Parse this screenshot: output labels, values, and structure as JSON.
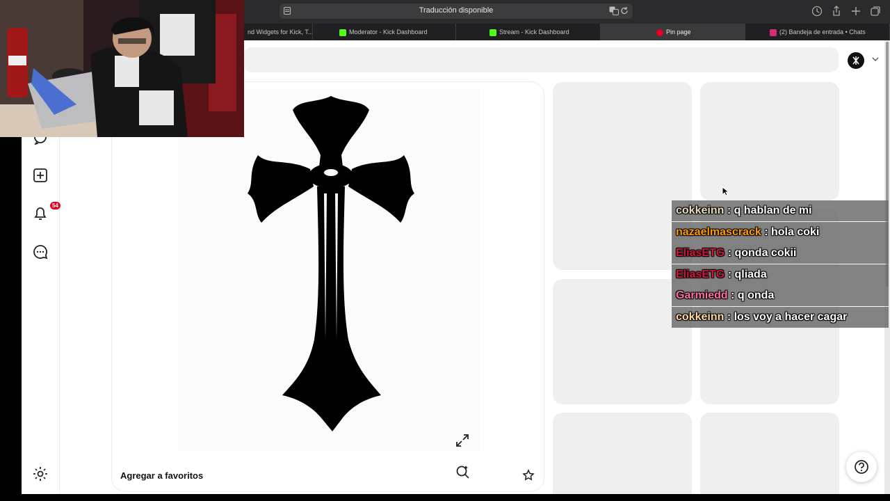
{
  "browser": {
    "address_text": "Traducción disponible",
    "tabs": [
      {
        "label": "nd Widgets for Kick, T...",
        "favicon_color": "#2d2d30"
      },
      {
        "label": "Moderator - Kick Dashboard",
        "favicon_color": "#53fc18"
      },
      {
        "label": "Stream - Kick Dashboard",
        "favicon_color": "#53fc18"
      },
      {
        "label": "Pin page",
        "favicon_color": "#e60023"
      },
      {
        "label": "(2) Bandeja de entrada • Chats",
        "favicon_color": "#d62976"
      }
    ]
  },
  "nav": {
    "notifications_badge": "54"
  },
  "pin": {
    "favorite_label": "Agregar a favoritos"
  },
  "chat": {
    "messages": [
      {
        "user": "cokkeinn",
        "user_color": "#e8dcc0",
        "text": ": q hablan de mi"
      },
      {
        "user": "nazaelmascrack",
        "user_color": "#ff9a00",
        "text": ": hola coki"
      },
      {
        "user": "EliasETG",
        "user_color": "#d4143c",
        "text": ": qonda cokii"
      },
      {
        "user": "EliasETG",
        "user_color": "#d4143c",
        "text": ": qliada"
      },
      {
        "user": "Garmiedd",
        "user_color": "#ff6fa0",
        "text": ": q onda"
      },
      {
        "user": "cokkeinn",
        "user_color": "#ffd7a0",
        "text": ": los voy a hacer cagar"
      }
    ]
  },
  "colors": {
    "pinterest_red": "#e60023",
    "kick_green": "#53fc18"
  }
}
